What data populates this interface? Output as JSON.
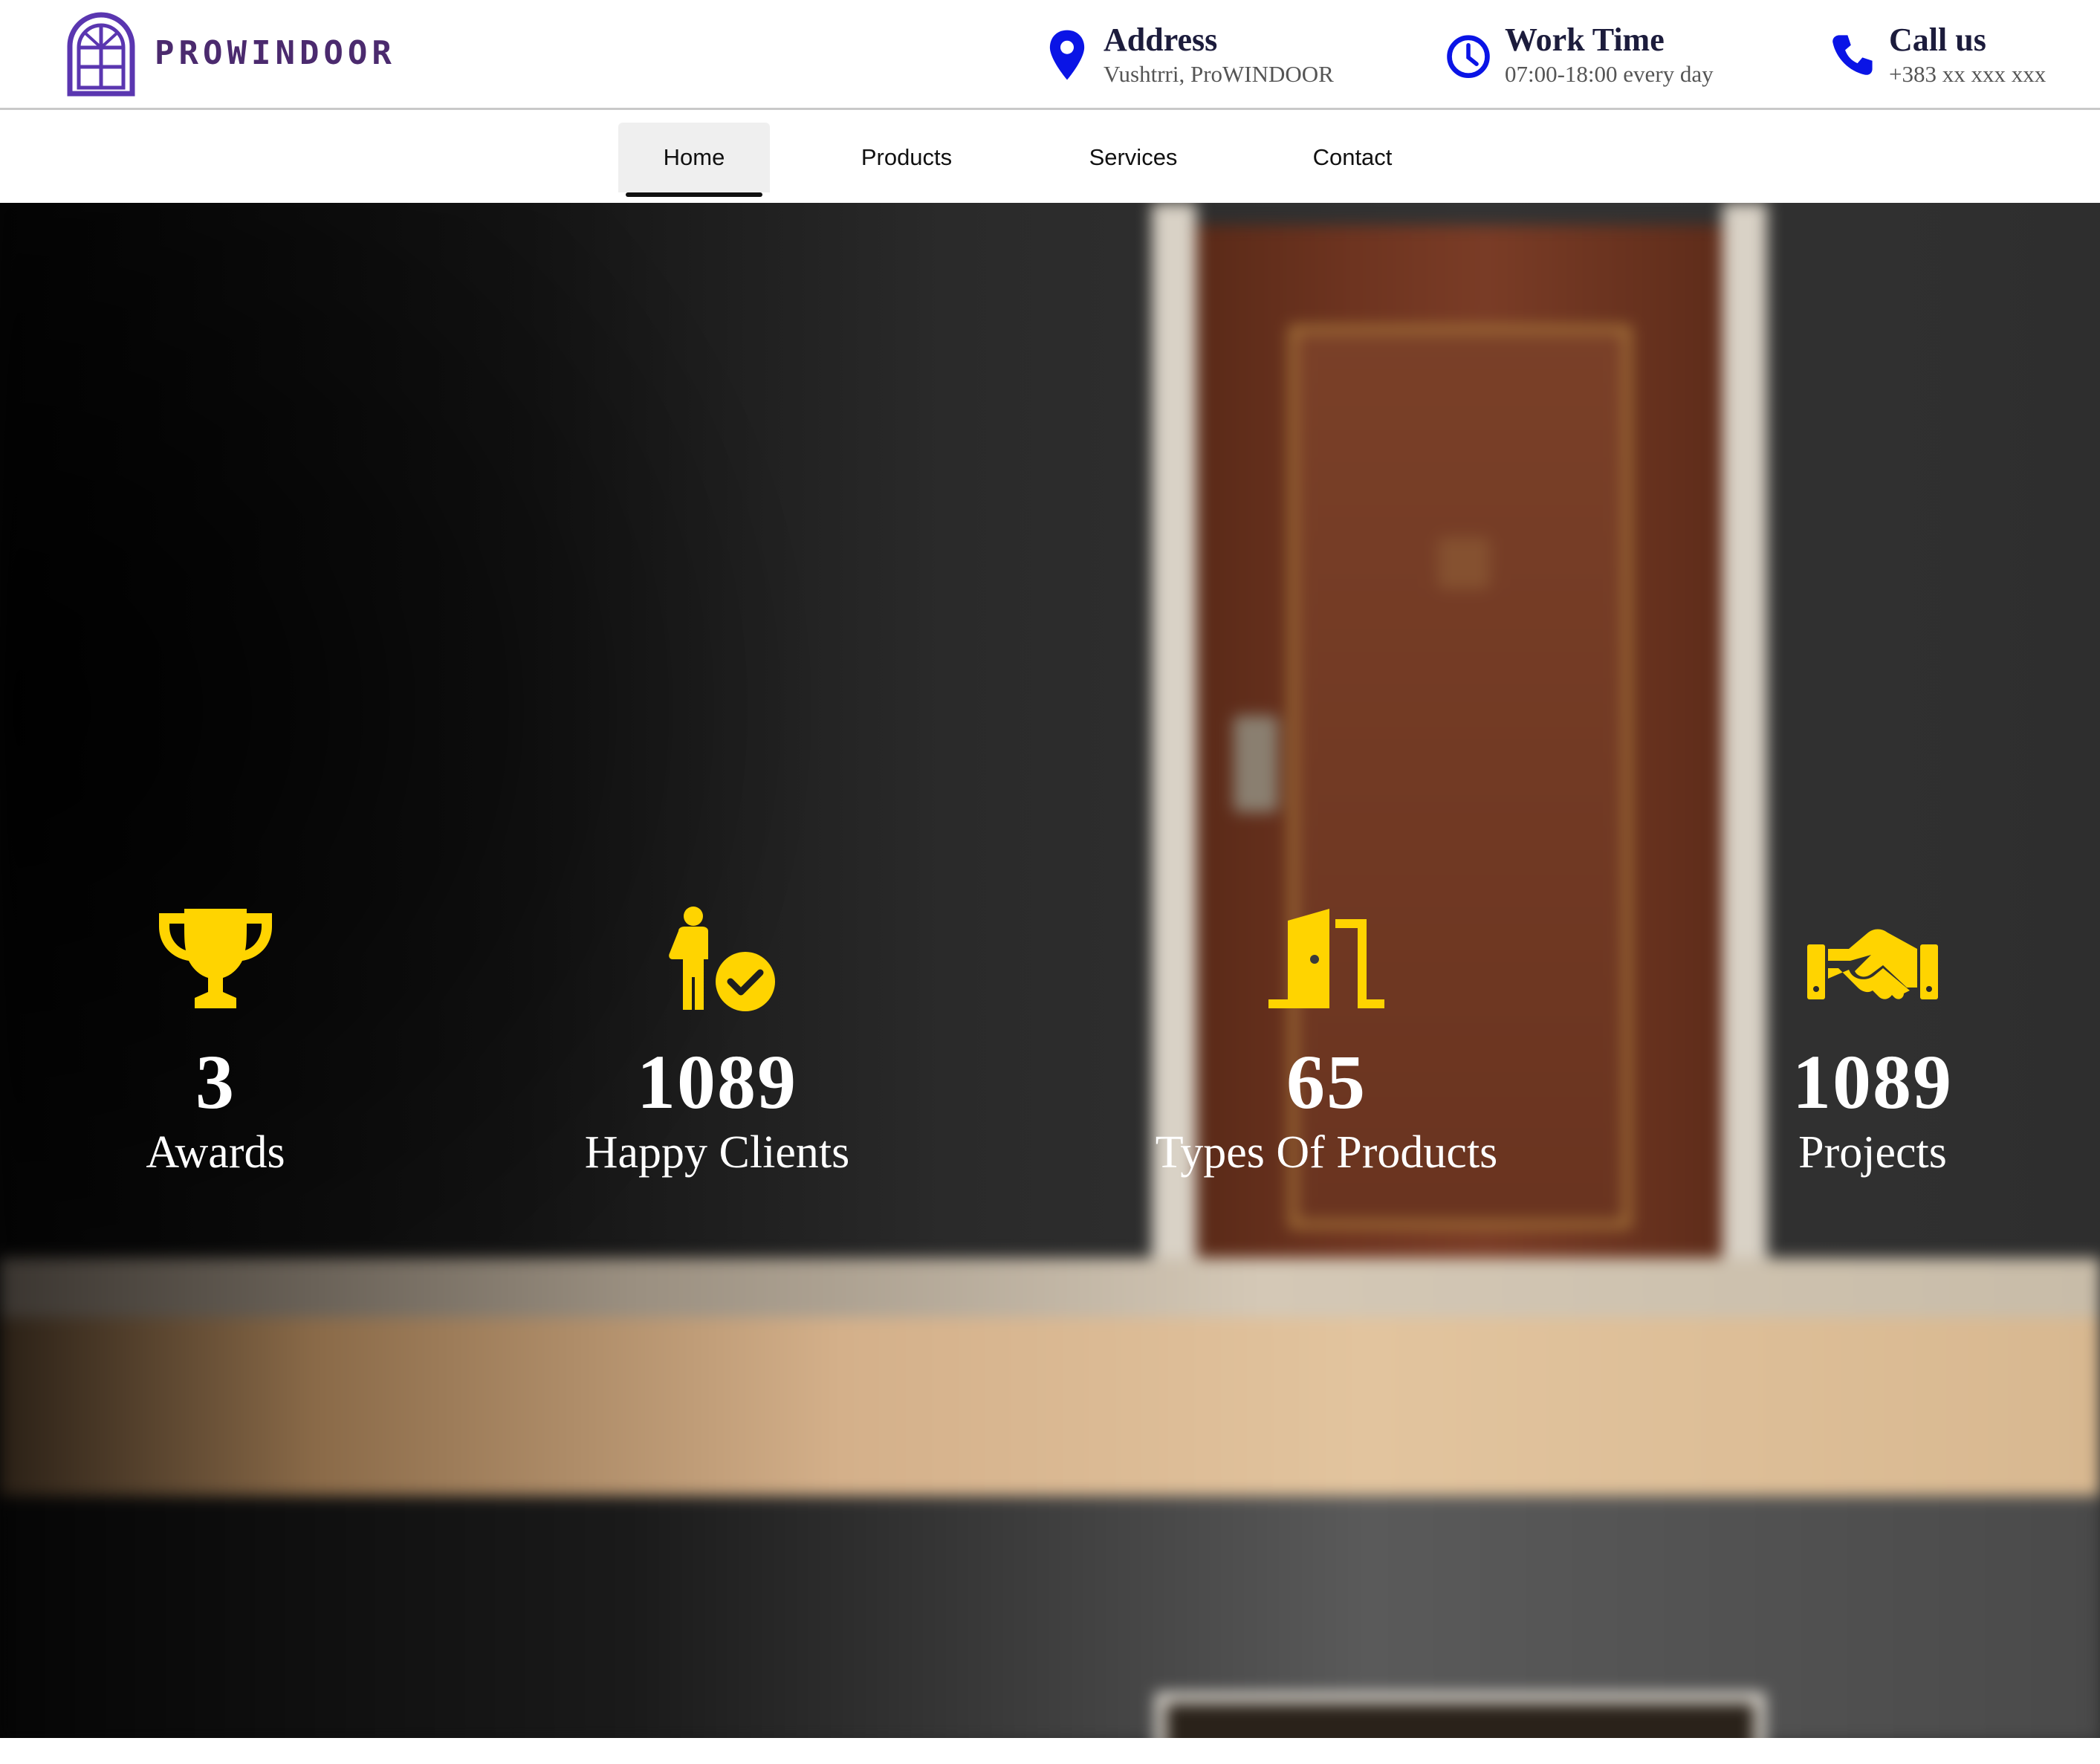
{
  "brand": {
    "name": "PROWINDOOR",
    "logo_icon": "window-arch-icon",
    "color": "#4b2a6e"
  },
  "contact": {
    "address": {
      "icon": "map-pin-icon",
      "title": "Address",
      "value": "Vushtrri, ProWINDOOR"
    },
    "work_time": {
      "icon": "clock-icon",
      "title": "Work Time",
      "value": "07:00-18:00 every day"
    },
    "call": {
      "icon": "phone-icon",
      "title": "Call us",
      "value": "+383 xx xxx xxx"
    },
    "icon_color": "#0a14e6"
  },
  "nav": {
    "items": [
      {
        "label": "Home",
        "active": true
      },
      {
        "label": "Products",
        "active": false
      },
      {
        "label": "Services",
        "active": false
      },
      {
        "label": "Contact",
        "active": false
      }
    ]
  },
  "stats": {
    "accent_color": "#ffd400",
    "items": [
      {
        "icon": "trophy-icon",
        "value": "3",
        "label": "Awards"
      },
      {
        "icon": "happy-client-icon",
        "value": "1089",
        "label": "Happy Clients"
      },
      {
        "icon": "door-open-icon",
        "value": "65",
        "label": "Types Of Products"
      },
      {
        "icon": "handshake-icon",
        "value": "1089",
        "label": "Projects"
      }
    ]
  }
}
